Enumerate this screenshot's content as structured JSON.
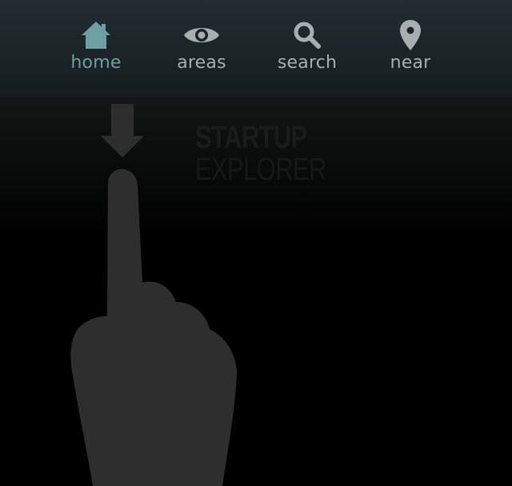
{
  "nav": {
    "items": [
      {
        "label": "home",
        "icon": "home-icon",
        "active": true
      },
      {
        "label": "areas",
        "icon": "eye-icon",
        "active": false
      },
      {
        "label": "search",
        "icon": "search-icon",
        "active": false
      },
      {
        "label": "near",
        "icon": "map-pin-icon",
        "active": false
      }
    ]
  },
  "logo": {
    "line1": "STARTUP",
    "line2": "EXPLORER"
  },
  "colors": {
    "active_icon": "#6e9fa5",
    "inactive_icon": "#a9aeb0",
    "nav_background": "#1c2428",
    "hand_overlay": "#2e2e2e"
  }
}
